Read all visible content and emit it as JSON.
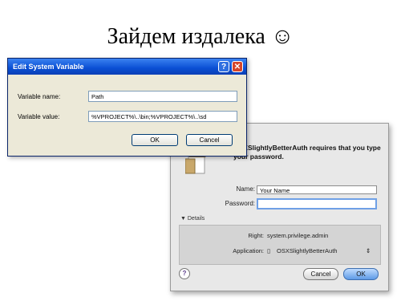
{
  "slide": {
    "title": "Зайдем издалека ☺"
  },
  "mac_dialog": {
    "message": "OSXSlightlyBetterAuth requires that you type your password.",
    "name_label": "Name:",
    "name_value": "Your Name",
    "password_label": "Password:",
    "password_value": "",
    "details_label": "Details",
    "right_label": "Right:",
    "right_value": "system.privilege.admin",
    "application_label": "Application:",
    "application_value": "OSXSlightlyBetterAuth",
    "cancel_label": "Cancel",
    "ok_label": "OK",
    "help_label": "?"
  },
  "win_dialog": {
    "title": "Edit System Variable",
    "help_label": "?",
    "close_label": "✕",
    "var_name_label": "Variable name:",
    "var_name_value": "Path",
    "var_value_label": "Variable value:",
    "var_value_value": "%VPROJECT%\\..\\bin;%VPROJECT%\\..\\sd",
    "ok_label": "OK",
    "cancel_label": "Cancel"
  }
}
